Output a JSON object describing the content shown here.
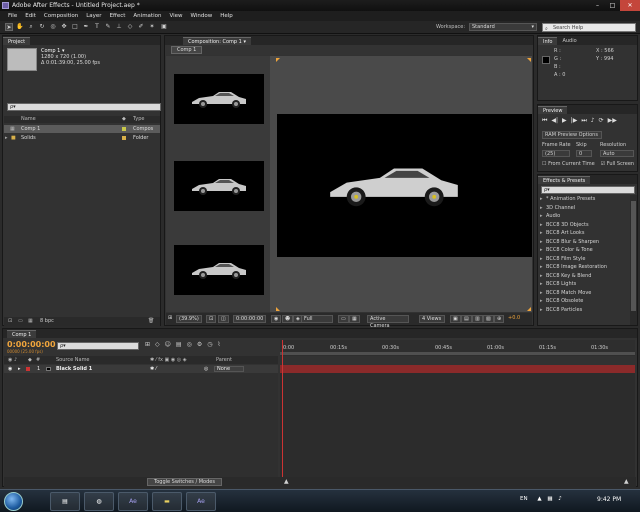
{
  "window": {
    "title": "Adobe After Effects - Untitled Project.aep *"
  },
  "menus": [
    "File",
    "Edit",
    "Composition",
    "Layer",
    "Effect",
    "Animation",
    "View",
    "Window",
    "Help"
  ],
  "toolbar": {
    "workspace_label": "Workspace:",
    "workspace_value": "Standard",
    "search_placeholder": "Search Help"
  },
  "project": {
    "tab": "Project",
    "selected_name": "Comp 1 ▾",
    "selected_res": "1280 x 720 (1.00)",
    "selected_dur": "Δ 0:01:39:00, 25.00 fps",
    "search_placeholder": "ρ▾",
    "col_name": "Name",
    "col_type": "Type",
    "items": [
      {
        "name": "Comp 1",
        "type": "Compos",
        "color": "#c8c84a"
      },
      {
        "name": "Solids",
        "type": "Folder",
        "color": "#d8b04a"
      }
    ],
    "bpc": "8 bpc"
  },
  "composition": {
    "tab": "Composition: Comp 1",
    "sub_tab": "Comp 1",
    "zoom": "(39.9%)",
    "timecode": "0:00:00:00",
    "resolution": "Full",
    "camera": "Active Camera",
    "views": "4 Views",
    "exposure": "+0.0"
  },
  "info": {
    "tab1": "Info",
    "tab2": "Audio",
    "r": "R :",
    "g": "G :",
    "b": "B :",
    "a": "A : 0",
    "x": "X : 566",
    "y": "Y : 994"
  },
  "preview": {
    "tab": "Preview",
    "ram_options": "RAM Preview Options",
    "frame_rate_label": "Frame Rate",
    "skip_label": "Skip",
    "resolution_label": "Resolution",
    "frame_rate_value": "(25)",
    "skip_value": "0",
    "resolution_value": "Auto",
    "from_current": "From Current Time",
    "full_screen": "Full Screen"
  },
  "effects": {
    "tab": "Effects & Presets",
    "search_placeholder": "ρ▾",
    "items": [
      "* Animation Presets",
      "3D Channel",
      "Audio",
      "BCC8 3D Objects",
      "BCC8 Art Looks",
      "BCC8 Blur & Sharpen",
      "BCC8 Color & Tone",
      "BCC8 Film Style",
      "BCC8 Image Restoration",
      "BCC8 Key & Blend",
      "BCC8 Lights",
      "BCC8 Match Move",
      "BCC8 Obsolete",
      "BCC8 Particles"
    ]
  },
  "timeline": {
    "tab": "Comp 1",
    "current_time": "0:00:00:00",
    "frame_info": "00000 (25.00 fps)",
    "search_placeholder": "ρ▾",
    "ruler": [
      "0:00",
      "00:15s",
      "00:30s",
      "00:45s",
      "01:00s",
      "01:15s",
      "01:30s"
    ],
    "col_source": "Source Name",
    "col_parent": "Parent",
    "layer_num": "1",
    "layer_name": "Black Solid 1",
    "layer_parent": "None",
    "toggle_modes": "Toggle Switches / Modes"
  },
  "taskbar": {
    "lang": "EN",
    "time": "9:42 PM"
  },
  "colors": {
    "accent_time": "#f0a53c",
    "layer_bar": "#8b2a2a",
    "playhead": "#cc3333"
  }
}
